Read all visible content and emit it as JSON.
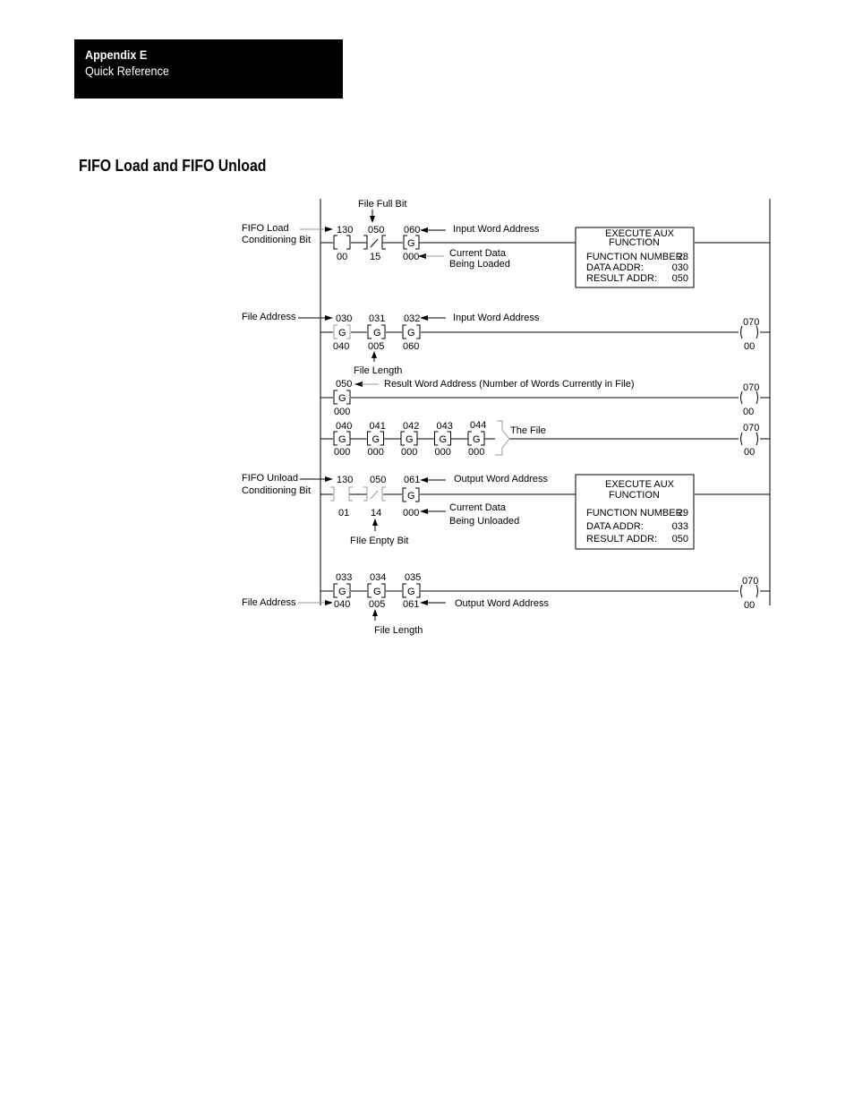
{
  "header": {
    "appendix": "Appendix E",
    "subtitle": "Quick Reference"
  },
  "section_title": "FIFO Load and FIFO Unload",
  "diagram": {
    "rungs": [
      {
        "id": "fifo-load-rung",
        "side_label": [
          "FIFO Load",
          "Conditioning Bit"
        ],
        "top_label": "File Full Bit",
        "elements": [
          {
            "type": "xic",
            "top": "130",
            "bottom": "00"
          },
          {
            "type": "xio",
            "top": "050",
            "bottom": "15"
          },
          {
            "type": "get",
            "top": "060",
            "bottom": "000",
            "glyph": "G"
          }
        ],
        "right_labels": [
          "Input Word Address",
          "Current Data",
          "Being Loaded"
        ],
        "aux_box": {
          "title": [
            "EXECUTE AUX",
            "FUNCTION"
          ],
          "rows": [
            {
              "label": "FUNCTION NUMBER:",
              "value": "28"
            },
            {
              "label": "DATA ADDR:",
              "value": "030"
            },
            {
              "label": "RESULT ADDR:",
              "value": "050"
            }
          ]
        }
      },
      {
        "id": "fifo-load-gets-rung",
        "side_label": [
          "File Address"
        ],
        "below_label": "File Length",
        "elements": [
          {
            "type": "get",
            "top": "030",
            "bottom": "040",
            "glyph": "G"
          },
          {
            "type": "get",
            "top": "031",
            "bottom": "005",
            "glyph": "G"
          },
          {
            "type": "get",
            "top": "032",
            "bottom": "060",
            "glyph": "G"
          }
        ],
        "right_labels": [
          "Input Word Address"
        ],
        "output": {
          "top": "070",
          "bottom": "00"
        }
      },
      {
        "id": "result-word-rung",
        "elements": [
          {
            "type": "get",
            "top": "050",
            "bottom": "000",
            "glyph": "G"
          }
        ],
        "right_labels": [
          "Result Word Address (Number of Words Currently in File)"
        ],
        "output": {
          "top": "070",
          "bottom": "00"
        }
      },
      {
        "id": "file-words-rung",
        "elements": [
          {
            "type": "get",
            "top": "040",
            "bottom": "000",
            "glyph": "G"
          },
          {
            "type": "get",
            "top": "041",
            "bottom": "000",
            "glyph": "G"
          },
          {
            "type": "get",
            "top": "042",
            "bottom": "000",
            "glyph": "G"
          },
          {
            "type": "get",
            "top": "043",
            "bottom": "000",
            "glyph": "G"
          },
          {
            "type": "get",
            "top": "044",
            "bottom": "000",
            "glyph": "G"
          }
        ],
        "right_labels": [
          "The File"
        ],
        "output": {
          "top": "070",
          "bottom": "00"
        }
      },
      {
        "id": "fifo-unload-rung",
        "side_label": [
          "FIFO Unload",
          "Conditioning Bit"
        ],
        "below_label": "FIle Enpty Bit",
        "elements": [
          {
            "type": "xic-open",
            "top": "130",
            "bottom": "01"
          },
          {
            "type": "xio",
            "top": "050",
            "bottom": "14"
          },
          {
            "type": "get",
            "top": "061",
            "bottom": "000",
            "glyph": "G"
          }
        ],
        "right_labels": [
          "Output Word Address",
          "Current Data",
          "Being Unloaded"
        ],
        "aux_box": {
          "title": [
            "EXECUTE AUX",
            "FUNCTION"
          ],
          "rows": [
            {
              "label": "FUNCTION NUMBER:",
              "value": "29"
            },
            {
              "label": "DATA ADDR:",
              "value": "033"
            },
            {
              "label": "RESULT ADDR:",
              "value": "050"
            }
          ]
        }
      },
      {
        "id": "fifo-unload-gets-rung",
        "side_label": [
          "File Address"
        ],
        "below_label": "File Length",
        "elements": [
          {
            "type": "get",
            "top": "033",
            "bottom": "040",
            "glyph": "G"
          },
          {
            "type": "get",
            "top": "034",
            "bottom": "005",
            "glyph": "G"
          },
          {
            "type": "get",
            "top": "035",
            "bottom": "061",
            "glyph": "G"
          }
        ],
        "right_labels": [
          "Output Word Address"
        ],
        "output": {
          "top": "070",
          "bottom": "00"
        }
      }
    ]
  }
}
